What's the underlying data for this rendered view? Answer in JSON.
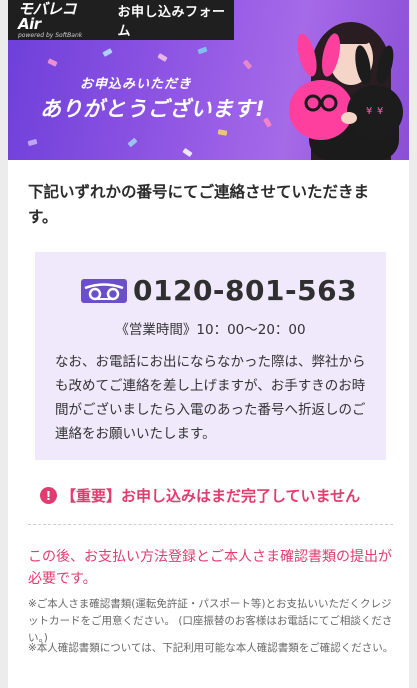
{
  "banner": {
    "logo_text": "モバレコAir",
    "logo_sub": "powered by SoftBank",
    "form_title": "お申し込みフォーム",
    "sub_catch": "お申込みいただき",
    "main_catch": "ありがとうございます!"
  },
  "intro_text": "下記いずれかの番号にてご連絡させていただきます。",
  "contact": {
    "phone": "0120-801-563",
    "hours": "《営業時間》10：00〜20：00",
    "note": "なお、お電話にお出にならなかった際は、弊社からも改めてご連絡を差し上げますが、お手すきのお時間がございましたら入電のあった番号へ折返しのご連絡をお願いいたします。"
  },
  "alert": {
    "icon": "!",
    "text": "【重要】お申し込みはまだ完了していません"
  },
  "next_steps": "この後、お支払い方法登録とご本人さま確認書類の提出が必要です。",
  "notes": [
    "※ご本人さま確認書類(運転免許証・パスポート等)とお支払いいただくクレジットカードをご用意ください。 (口座振替のお客様はお電話にてご相談ください。)",
    "※本人確認書類については、下記利用可能な本人確認書類をご確認ください。"
  ],
  "colors": {
    "accent": "#e03c6f",
    "banner_purple": "#8e54e3",
    "box_bg": "#efe9fb",
    "freedial_icon": "#6a4fc8"
  },
  "icons": {
    "freedial": "free-dial-icon",
    "alert": "exclamation-circle-icon"
  }
}
